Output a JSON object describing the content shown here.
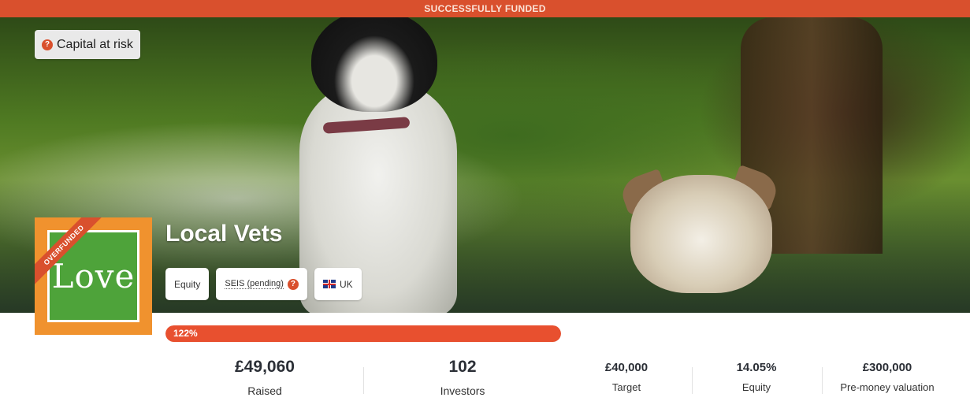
{
  "banner": {
    "text": "SUCCESSFULLY FUNDED"
  },
  "risk": {
    "label": "Capital at risk",
    "icon": "question-icon"
  },
  "logo": {
    "ribbon": "OVERFUNDED",
    "text": "Love",
    "bg_color": "#f0922e",
    "inner_color": "#4ea33a"
  },
  "company": {
    "name": "Local Vets"
  },
  "tags": {
    "equity": "Equity",
    "seis": "SEIS (pending)",
    "country": "UK",
    "country_flag": "uk-flag-icon"
  },
  "progress": {
    "label": "122%",
    "fraction": 1.0,
    "color": "#e8502f"
  },
  "stats": {
    "raised": {
      "value": "£49,060",
      "label": "Raised"
    },
    "investors": {
      "value": "102",
      "label": "Investors"
    },
    "target": {
      "value": "£40,000",
      "label": "Target"
    },
    "equity": {
      "value": "14.05%",
      "label": "Equity"
    },
    "valuation": {
      "value": "£300,000",
      "label": "Pre-money valuation"
    }
  },
  "colors": {
    "accent": "#d9502d"
  }
}
